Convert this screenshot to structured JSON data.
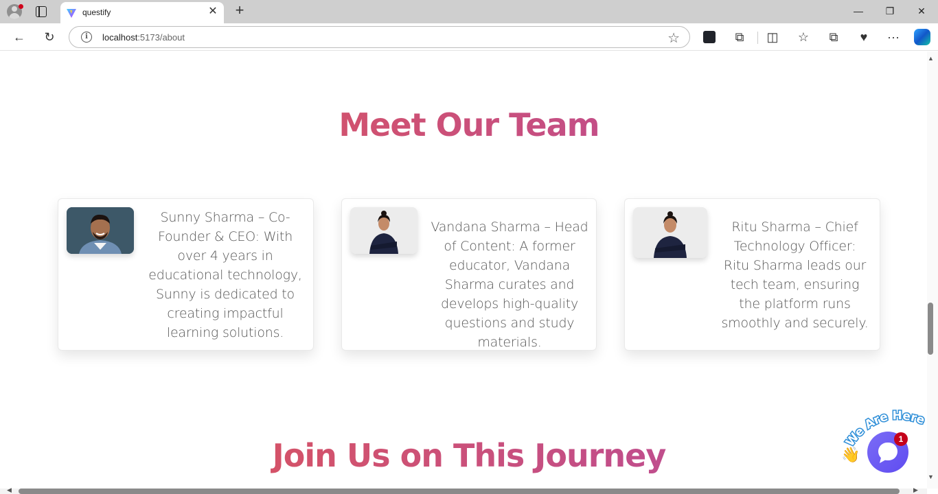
{
  "browser": {
    "tab_title": "questify",
    "url_host": "localhost",
    "url_path": ":5173/about",
    "new_tab": "+",
    "tab_close": "✕",
    "minimize": "—",
    "restore": "❐",
    "close": "✕"
  },
  "toolbar": {
    "back": "←",
    "reload": "↻",
    "star": "☆",
    "extensions": "⧉",
    "split": "◫",
    "favorites": "☆",
    "collections": "⧉",
    "performance": "♥",
    "more": "···"
  },
  "team_section": {
    "title": "Meet Our Team",
    "members": [
      {
        "text": "Sunny Sharma – Co-Founder & CEO: With over 4 years in educational technology, Sunny is dedicated to creating impactful learning solutions."
      },
      {
        "text": "Vandana Sharma – Head of Content: A former educator, Vandana Sharma curates and develops high-quality questions and study materials."
      },
      {
        "text": "Ritu Sharma – Chief Technology Officer: Ritu Sharma leads our tech team, ensuring the platform runs smoothly and securely."
      }
    ]
  },
  "join_section": {
    "title": "Join Us on This Journey"
  },
  "chat_widget": {
    "label": "We Are Here!",
    "badge_count": "1",
    "wave_icon": "👋"
  }
}
